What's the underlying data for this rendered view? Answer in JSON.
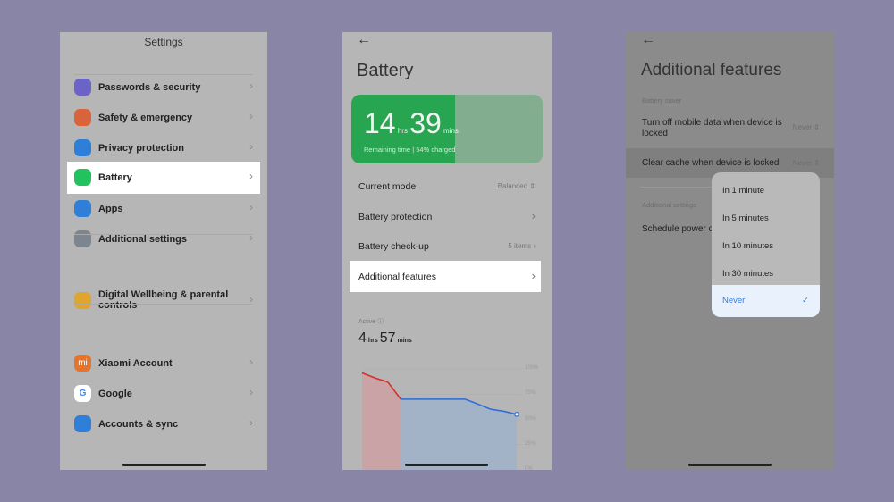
{
  "screen1": {
    "title": "Settings",
    "items": [
      {
        "label": "Passwords & security",
        "icon": "fingerprint-icon",
        "color": "#6c63c9"
      },
      {
        "label": "Safety & emergency",
        "icon": "emergency-icon",
        "color": "#d9643c"
      },
      {
        "label": "Privacy protection",
        "icon": "privacy-icon",
        "color": "#2f7fd8"
      },
      {
        "label": "Battery",
        "icon": "battery-icon",
        "color": "#22c35e",
        "highlighted": true
      },
      {
        "label": "Apps",
        "icon": "gear-icon",
        "color": "#2f7fd8"
      },
      {
        "label": "Additional settings",
        "icon": "more-icon",
        "color": "#7d8590"
      },
      {
        "label": "Digital Wellbeing & parental controls",
        "icon": "wellbeing-icon",
        "color": "#e0a52c"
      },
      {
        "label": "Xiaomi Account",
        "icon": "mi-icon",
        "color": "#e4742d"
      },
      {
        "label": "Google",
        "icon": "google-icon",
        "color": "#ffffff"
      },
      {
        "label": "Accounts & sync",
        "icon": "account-icon",
        "color": "#2f7fd8"
      }
    ]
  },
  "screen2": {
    "title": "Battery",
    "hours": "14",
    "hrs": "hrs",
    "mins_val": "39",
    "mins": "mins",
    "remaining": "Remaining time | 54% charged",
    "charge_percent": 54,
    "rows": [
      {
        "label": "Current mode",
        "value": "Balanced ⇕"
      },
      {
        "label": "Battery protection",
        "value": "›"
      },
      {
        "label": "Battery check-up",
        "value": "5 items ›"
      },
      {
        "label": "Additional features",
        "value": "›",
        "highlighted": true
      }
    ],
    "active_label": "Active",
    "active_hours": "4",
    "active_hrs": "hrs",
    "active_mins": "57",
    "active_mins_unit": "mins"
  },
  "chart_data": {
    "type": "line",
    "yticks": [
      "100%",
      "75%",
      "50%",
      "25%",
      "0%"
    ],
    "ylim": [
      0,
      100
    ],
    "values": [
      96,
      91,
      87,
      70,
      70,
      70,
      70,
      70,
      70,
      65,
      60,
      58,
      55
    ],
    "discharging_segments": [
      [
        0,
        3
      ]
    ],
    "colors": {
      "line": "#2f6fd6",
      "drain": "#d3302a"
    }
  },
  "screen3": {
    "title": "Additional features",
    "section1": "Battery saver",
    "row1": {
      "label": "Turn off mobile data when device is locked",
      "value": "Never"
    },
    "row2": {
      "label": "Clear cache when device is locked",
      "value": "Never"
    },
    "section2": "Additional settings",
    "row3": "Schedule power o",
    "options": [
      "In 1 minute",
      "In 5 minutes",
      "In 10 minutes",
      "In 30 minutes",
      "Never"
    ],
    "selected": "Never",
    "accent": "#3a7ee0"
  }
}
